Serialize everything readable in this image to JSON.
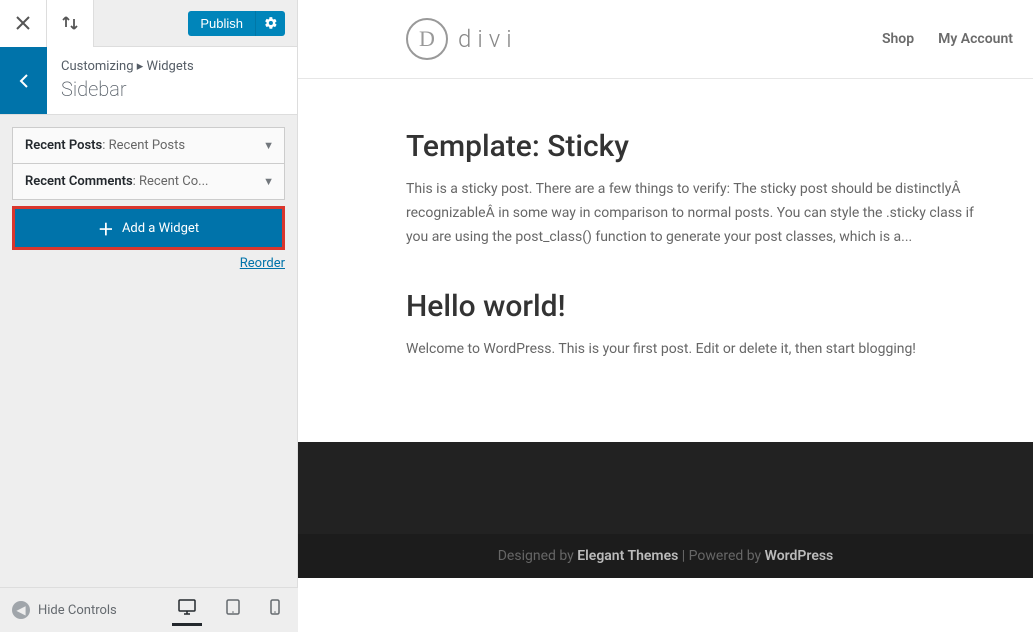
{
  "topbar": {
    "publish_label": "Publish"
  },
  "breadcrumb": {
    "parent": "Customizing",
    "separator": "▸",
    "section": "Widgets"
  },
  "section_title": "Sidebar",
  "widgets": [
    {
      "name": "Recent Posts",
      "subtitle": "Recent Posts"
    },
    {
      "name": "Recent Comments",
      "subtitle": "Recent Co..."
    }
  ],
  "add_widget_label": "Add a Widget",
  "reorder_label": "Reorder",
  "footer": {
    "hide_controls_label": "Hide Controls"
  },
  "preview": {
    "logo_letter": "D",
    "logo_text": "divi",
    "nav": [
      {
        "label": "Shop"
      },
      {
        "label": "My Account"
      }
    ],
    "posts": [
      {
        "title": "Template: Sticky",
        "excerpt": "This is a sticky post. There are a few things to verify: The sticky post should be distinctlyÂ recognizableÂ in some way in comparison to normal posts. You can style the .sticky class if you are using the post_class() function to generate your post classes, which is a..."
      },
      {
        "title": "Hello world!",
        "excerpt": "Welcome to WordPress. This is your first post. Edit or delete it, then start blogging!"
      }
    ],
    "footer": {
      "designed_by": "Designed by ",
      "theme": "Elegant Themes",
      "powered_by": " | Powered by ",
      "platform": "WordPress"
    }
  }
}
